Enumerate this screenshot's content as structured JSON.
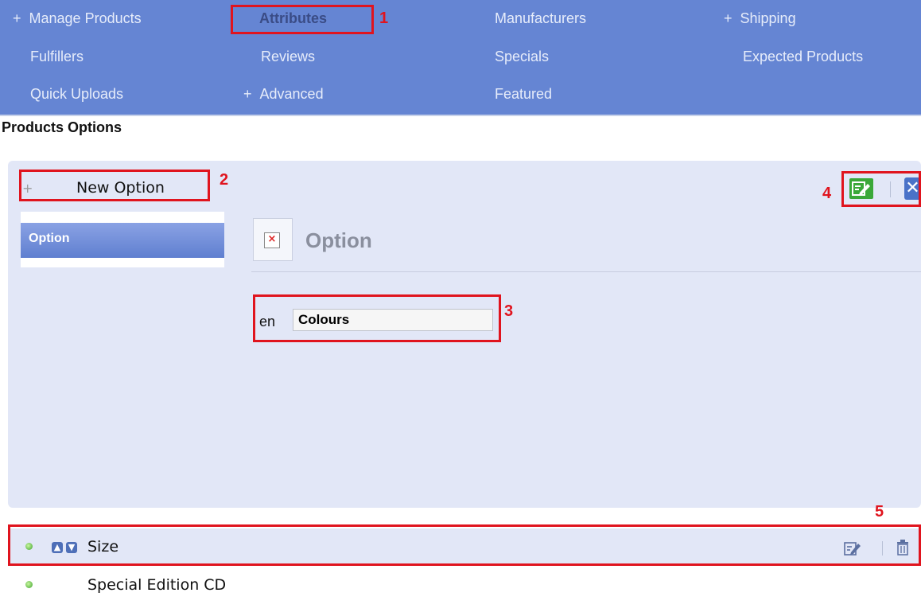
{
  "nav": {
    "row1": [
      "Manage Products",
      "Attributes",
      "Manufacturers",
      "Shipping"
    ],
    "row2": [
      "Fulfillers",
      "Reviews",
      "Specials",
      "Expected Products"
    ],
    "row3": [
      "Quick Uploads",
      "Advanced",
      "Featured"
    ],
    "plus": "+"
  },
  "page_title": "Products Options",
  "new_option": {
    "icon": "+",
    "label": "New Option"
  },
  "sidebar": {
    "tab_label": "Option"
  },
  "editor": {
    "heading": "Option",
    "lang_code": "en",
    "value": "Colours"
  },
  "rows": [
    {
      "label": "Size"
    },
    {
      "label": "Special Edition CD"
    }
  ],
  "annotations": [
    "1",
    "2",
    "3",
    "4",
    "5"
  ],
  "colors": {
    "nav_bg": "#6585d3",
    "panel_bg": "#e2e7f7",
    "annotation": "#e0141e",
    "save": "#3aa838"
  }
}
